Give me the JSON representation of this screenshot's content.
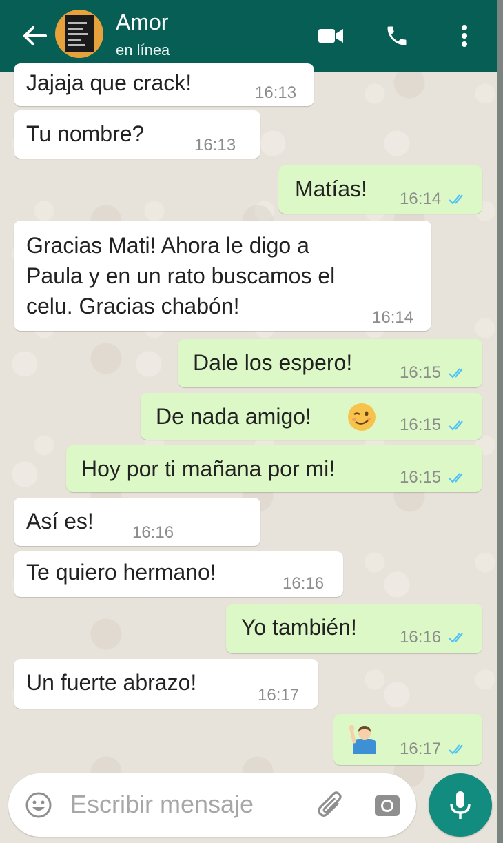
{
  "header": {
    "contact_name": "Amor",
    "status": "en línea",
    "icons": [
      "back-arrow-icon",
      "video-call-icon",
      "phone-icon",
      "more-vert-icon"
    ]
  },
  "messages": [
    {
      "dir": "in",
      "text": "Jajaja que crack!",
      "time": "16:13"
    },
    {
      "dir": "in",
      "text": "Tu nombre?",
      "time": "16:13"
    },
    {
      "dir": "out",
      "text": "Matías!",
      "time": "16:14",
      "read": true
    },
    {
      "dir": "in",
      "lines": [
        "Gracias Mati! Ahora le digo a",
        "Paula y en un rato buscamos el",
        "celu. Gracias chabón!"
      ],
      "time": "16:14"
    },
    {
      "dir": "out",
      "text": "Dale los espero!",
      "time": "16:15",
      "read": true
    },
    {
      "dir": "out",
      "text": "De nada amigo!",
      "emoji": "winking-face",
      "time": "16:15",
      "read": true
    },
    {
      "dir": "out",
      "text": "Hoy por ti mañana por mi!",
      "time": "16:15",
      "read": true
    },
    {
      "dir": "in",
      "text": "Así es!",
      "time": "16:16"
    },
    {
      "dir": "in",
      "text": "Te quiero hermano!",
      "time": "16:16"
    },
    {
      "dir": "out",
      "text": "Yo también!",
      "time": "16:16",
      "read": true
    },
    {
      "dir": "in",
      "text": "Un fuerte abrazo!",
      "time": "16:17"
    },
    {
      "dir": "out",
      "emoji": "person-raising-hand",
      "time": "16:17",
      "read": true
    }
  ],
  "input": {
    "placeholder": "Escribir mensaje",
    "icons": [
      "emoji-icon",
      "attach-icon",
      "camera-icon",
      "mic-icon"
    ]
  },
  "colors": {
    "header": "#075e54",
    "incoming": "#ffffff",
    "outgoing": "#dcf8c6",
    "read_ticks": "#4fc3f7",
    "mic_button": "#128c7e"
  }
}
